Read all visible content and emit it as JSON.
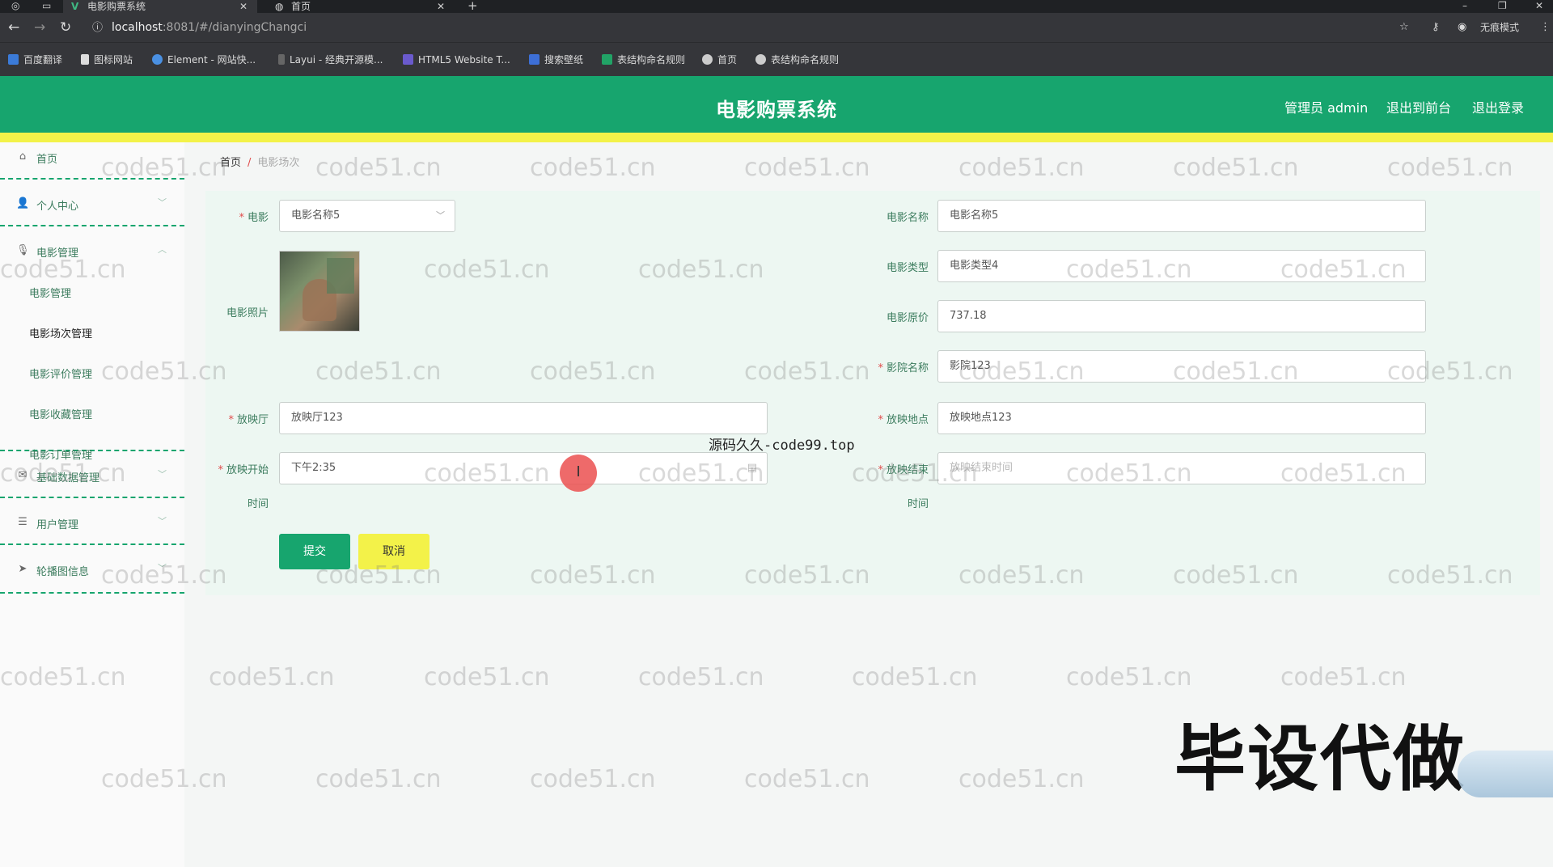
{
  "browser": {
    "tabs": [
      {
        "title": "电影购票系统",
        "icon": "vue-logo-icon",
        "active": true
      },
      {
        "title": "首页",
        "icon": "globe-icon",
        "active": false
      }
    ],
    "new_tab": "+",
    "url_host": "localhost",
    "url_path": ":8081/#/dianyingChangci",
    "incognito_label": "无痕模式",
    "bookmarks": [
      "百度翻译",
      "图标网站",
      "Element - 网站快...",
      "Layui - 经典开源模...",
      "HTML5 Website T...",
      "搜索壁纸",
      "表结构命名规则",
      "首页",
      "表结构命名规则"
    ]
  },
  "header": {
    "title": "电影购票系统",
    "admin": "管理员 admin",
    "to_front": "退出到前台",
    "logout": "退出登录"
  },
  "sidebar": {
    "items": [
      {
        "label": "首页",
        "icon": "home-icon"
      },
      {
        "label": "个人中心",
        "icon": "user-icon"
      },
      {
        "label": "电影管理",
        "icon": "microphone-icon"
      },
      {
        "label": "基础数据管理",
        "icon": "mail-icon"
      },
      {
        "label": "用户管理",
        "icon": "menu-icon"
      },
      {
        "label": "轮播图信息",
        "icon": "send-icon"
      }
    ],
    "sub_items": [
      "电影管理",
      "电影场次管理",
      "电影评价管理",
      "电影收藏管理",
      "电影订单管理"
    ]
  },
  "breadcrumb": {
    "home": "首页",
    "sep": "/",
    "current": "电影场次"
  },
  "form": {
    "movie_label": "电影",
    "movie_value": "电影名称5",
    "photo_label": "电影照片",
    "hall_label": "放映厅",
    "hall_value": "放映厅123",
    "start_label_1": "放映开始",
    "start_label_2": "时间",
    "start_value": "下午2:35",
    "movie_name_label": "电影名称",
    "movie_name_value": "电影名称5",
    "movie_type_label": "电影类型",
    "movie_type_value": "电影类型4",
    "price_label": "电影原价",
    "price_value": "737.18",
    "cinema_label": "影院名称",
    "cinema_value": "影院123",
    "location_label": "放映地点",
    "location_value": "放映地点123",
    "end_label_1": "放映结束",
    "end_label_2": "时间",
    "end_placeholder": "放映结束时间",
    "submit": "提交",
    "cancel": "取消"
  },
  "overlay": {
    "watermark": "code51.cn",
    "source_text": "源码久久-code99.top",
    "promo": "毕设代做",
    "cursor_glyph": "I"
  },
  "colors": {
    "primary": "#17a56e",
    "accent_yellow": "#f3f249",
    "required": "#e04c4c"
  }
}
